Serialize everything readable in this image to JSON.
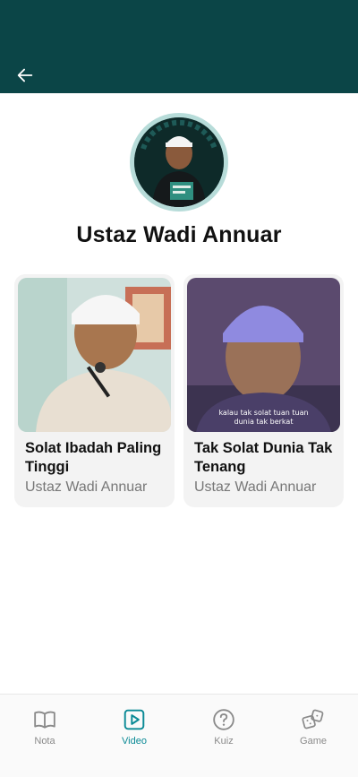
{
  "header": {
    "back_icon": "arrow-left-icon"
  },
  "profile": {
    "name": "Ustaz Wadi Annuar",
    "avatar_badge": ""
  },
  "videos": [
    {
      "title": "Solat Ibadah Paling Tinggi",
      "speaker": "Ustaz Wadi Annuar",
      "caption": ""
    },
    {
      "title": "Tak Solat Dunia Tak Tenang",
      "speaker": "Ustaz Wadi Annuar",
      "caption_line1": "kalau tak solat tuan tuan",
      "caption_line2": "dunia tak berkat"
    }
  ],
  "bottom_nav": [
    {
      "label": "Nota",
      "icon": "book-icon",
      "active": false
    },
    {
      "label": "Video",
      "icon": "play-icon",
      "active": true
    },
    {
      "label": "Kuiz",
      "icon": "question-icon",
      "active": false
    },
    {
      "label": "Game",
      "icon": "dice-icon",
      "active": false
    }
  ],
  "colors": {
    "header": "#0b4547",
    "accent": "#0b8a96",
    "ring": "#b7dcd9"
  }
}
